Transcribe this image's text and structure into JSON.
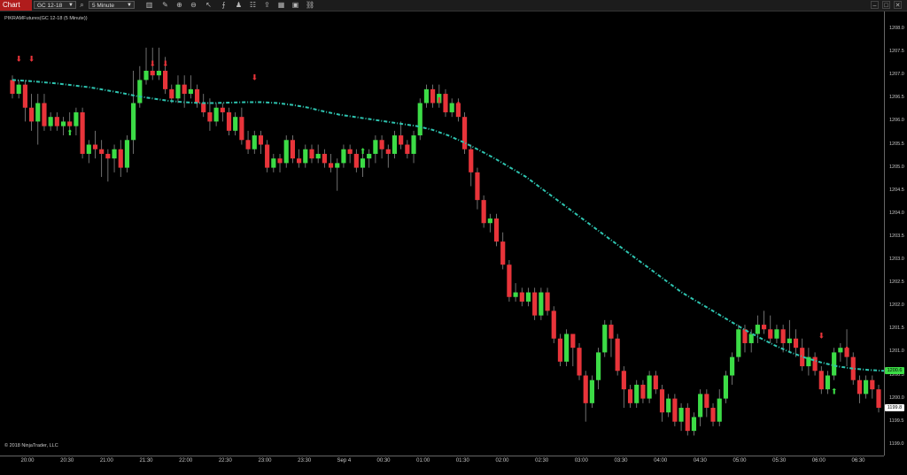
{
  "toolbar": {
    "chart_tab": "Chart",
    "instrument": "GC 12-18",
    "interval": "5 Minute",
    "icons": [
      "search-icon",
      "bar-type-icon",
      "pencil-icon",
      "zoom-in-icon",
      "zoom-out-icon",
      "cursor-icon",
      "indicator-icon",
      "strategy-icon",
      "properties-icon",
      "share-icon",
      "grid-icon",
      "data-box-icon",
      "link-icon"
    ],
    "window_buttons": [
      "minimize-icon",
      "maximize-icon",
      "close-icon"
    ]
  },
  "indicator_label": "PIKRAMFutures(GC 12-18 (5 Minute))",
  "copyright": "© 2018 NinjaTrader, LLC",
  "colors": {
    "up": "#3cdc46",
    "down": "#e8343a",
    "ma": "#2ec4b0",
    "up_arrow": "#3cdc46",
    "down_arrow": "#e8343a"
  },
  "chart_data": {
    "type": "candlestick",
    "instrument": "GC 12-18",
    "interval": "5 Minute",
    "y_tick_labels": [
      "1208.0",
      "1207.5",
      "1207.0",
      "1206.5",
      "1206.0",
      "1205.5",
      "1205.0",
      "1204.5",
      "1204.0",
      "1203.5",
      "1203.0",
      "1202.5",
      "1202.0",
      "1201.5",
      "1201.0",
      "1200.5",
      "1200.0",
      "1199.5",
      "1199.0"
    ],
    "x_tick_labels": [
      "20:00",
      "20:30",
      "21:00",
      "21:30",
      "22:00",
      "22:30",
      "23:00",
      "23:30",
      "Sep 4",
      "00:30",
      "01:00",
      "01:30",
      "02:00",
      "02:30",
      "03:00",
      "03:30",
      "04:00",
      "04:30",
      "05:00",
      "05:30",
      "06:00",
      "06:30"
    ],
    "ylim": [
      1198.5,
      1208.2
    ],
    "last_price_label": "1199.8",
    "ma_price_label": "1200.6",
    "candles": [
      [
        1206.9,
        1206.6,
        1206.5,
        1207.0
      ],
      [
        1206.6,
        1206.8,
        1206.5,
        1206.9
      ],
      [
        1206.8,
        1206.3,
        1206.0,
        1206.9
      ],
      [
        1206.3,
        1206.0,
        1205.8,
        1206.6
      ],
      [
        1206.0,
        1206.4,
        1205.5,
        1206.6
      ],
      [
        1206.4,
        1205.9,
        1205.8,
        1206.6
      ],
      [
        1205.9,
        1206.1,
        1205.8,
        1206.2
      ],
      [
        1206.1,
        1205.9,
        1205.8,
        1206.2
      ],
      [
        1205.9,
        1206.0,
        1205.7,
        1206.1
      ],
      [
        1206.0,
        1205.9,
        1205.8,
        1206.2
      ],
      [
        1205.9,
        1206.2,
        1205.7,
        1206.3
      ],
      [
        1206.2,
        1205.3,
        1205.2,
        1206.3
      ],
      [
        1205.3,
        1205.5,
        1205.1,
        1205.6
      ],
      [
        1205.5,
        1205.4,
        1205.2,
        1205.8
      ],
      [
        1205.4,
        1205.3,
        1204.8,
        1205.6
      ],
      [
        1205.3,
        1205.2,
        1204.7,
        1205.4
      ],
      [
        1205.2,
        1205.4,
        1204.9,
        1205.5
      ],
      [
        1205.4,
        1205.0,
        1204.8,
        1205.6
      ],
      [
        1205.0,
        1205.6,
        1204.9,
        1205.7
      ],
      [
        1205.6,
        1206.4,
        1205.3,
        1207.1
      ],
      [
        1206.4,
        1206.9,
        1206.3,
        1207.2
      ],
      [
        1206.9,
        1207.1,
        1206.8,
        1207.6
      ],
      [
        1207.1,
        1207.0,
        1206.9,
        1207.6
      ],
      [
        1207.0,
        1207.1,
        1206.9,
        1207.6
      ],
      [
        1207.1,
        1206.7,
        1206.6,
        1207.4
      ],
      [
        1206.7,
        1206.5,
        1206.4,
        1206.8
      ],
      [
        1206.5,
        1206.8,
        1206.4,
        1207.0
      ],
      [
        1206.8,
        1206.6,
        1206.3,
        1207.0
      ],
      [
        1206.6,
        1206.7,
        1206.5,
        1207.0
      ],
      [
        1206.7,
        1206.4,
        1206.3,
        1206.8
      ],
      [
        1206.4,
        1206.2,
        1206.1,
        1206.6
      ],
      [
        1206.2,
        1206.0,
        1205.8,
        1206.5
      ],
      [
        1206.0,
        1206.3,
        1205.9,
        1206.4
      ],
      [
        1206.3,
        1206.2,
        1206.0,
        1206.4
      ],
      [
        1206.2,
        1205.8,
        1205.7,
        1206.3
      ],
      [
        1205.8,
        1206.1,
        1205.7,
        1206.2
      ],
      [
        1206.1,
        1205.6,
        1205.5,
        1206.3
      ],
      [
        1205.6,
        1205.4,
        1205.3,
        1205.8
      ],
      [
        1205.4,
        1205.7,
        1205.3,
        1205.8
      ],
      [
        1205.7,
        1205.5,
        1205.3,
        1205.8
      ],
      [
        1205.5,
        1205.0,
        1204.9,
        1205.6
      ],
      [
        1205.0,
        1205.2,
        1204.9,
        1205.3
      ],
      [
        1205.2,
        1205.1,
        1204.9,
        1205.3
      ],
      [
        1205.1,
        1205.6,
        1205.0,
        1205.7
      ],
      [
        1205.6,
        1205.2,
        1205.1,
        1205.7
      ],
      [
        1205.2,
        1205.1,
        1205.0,
        1205.4
      ],
      [
        1205.1,
        1205.4,
        1205.0,
        1205.5
      ],
      [
        1205.4,
        1205.2,
        1205.1,
        1205.5
      ],
      [
        1205.2,
        1205.3,
        1205.1,
        1205.5
      ],
      [
        1205.3,
        1205.1,
        1205.0,
        1205.4
      ],
      [
        1205.1,
        1205.0,
        1204.9,
        1205.3
      ],
      [
        1205.0,
        1205.1,
        1204.5,
        1205.2
      ],
      [
        1205.1,
        1205.4,
        1205.0,
        1205.5
      ],
      [
        1205.4,
        1205.3,
        1205.1,
        1205.5
      ],
      [
        1205.3,
        1205.0,
        1204.9,
        1205.4
      ],
      [
        1205.0,
        1205.2,
        1204.8,
        1205.3
      ],
      [
        1205.2,
        1205.3,
        1205.0,
        1205.4
      ],
      [
        1205.3,
        1205.6,
        1205.1,
        1205.7
      ],
      [
        1205.6,
        1205.4,
        1205.2,
        1205.7
      ],
      [
        1205.4,
        1205.3,
        1205.0,
        1205.5
      ],
      [
        1205.3,
        1205.7,
        1205.2,
        1205.8
      ],
      [
        1205.7,
        1205.5,
        1205.4,
        1206.0
      ],
      [
        1205.5,
        1205.3,
        1205.2,
        1205.6
      ],
      [
        1205.3,
        1205.7,
        1205.1,
        1205.8
      ],
      [
        1205.7,
        1206.4,
        1205.6,
        1206.5
      ],
      [
        1206.4,
        1206.7,
        1206.3,
        1206.8
      ],
      [
        1206.7,
        1206.4,
        1206.3,
        1206.8
      ],
      [
        1206.4,
        1206.6,
        1206.3,
        1206.8
      ],
      [
        1206.6,
        1206.2,
        1206.1,
        1206.7
      ],
      [
        1206.2,
        1206.4,
        1206.1,
        1206.5
      ],
      [
        1206.4,
        1206.1,
        1206.0,
        1206.5
      ],
      [
        1206.1,
        1205.4,
        1205.3,
        1206.2
      ],
      [
        1205.4,
        1204.9,
        1204.6,
        1205.5
      ],
      [
        1204.9,
        1204.3,
        1204.1,
        1205.0
      ],
      [
        1204.3,
        1203.8,
        1203.7,
        1204.4
      ],
      [
        1203.8,
        1203.9,
        1203.6,
        1204.0
      ],
      [
        1203.9,
        1203.4,
        1203.3,
        1204.0
      ],
      [
        1203.4,
        1202.9,
        1202.8,
        1203.6
      ],
      [
        1202.9,
        1202.2,
        1202.1,
        1203.0
      ],
      [
        1202.2,
        1202.3,
        1202.1,
        1202.5
      ],
      [
        1202.3,
        1202.1,
        1202.0,
        1202.4
      ],
      [
        1202.1,
        1202.3,
        1202.0,
        1202.4
      ],
      [
        1202.3,
        1201.8,
        1201.7,
        1202.4
      ],
      [
        1201.8,
        1202.3,
        1201.7,
        1202.4
      ],
      [
        1202.3,
        1201.9,
        1201.8,
        1202.4
      ],
      [
        1201.9,
        1201.3,
        1201.2,
        1202.0
      ],
      [
        1201.3,
        1200.8,
        1200.7,
        1201.4
      ],
      [
        1200.8,
        1201.4,
        1200.7,
        1201.5
      ],
      [
        1201.4,
        1201.1,
        1200.7,
        1201.4
      ],
      [
        1201.1,
        1200.5,
        1200.4,
        1201.2
      ],
      [
        1200.5,
        1199.9,
        1199.5,
        1200.6
      ],
      [
        1199.9,
        1200.4,
        1199.8,
        1200.5
      ],
      [
        1200.4,
        1201.0,
        1200.2,
        1201.1
      ],
      [
        1201.0,
        1201.6,
        1200.9,
        1201.7
      ],
      [
        1201.6,
        1201.3,
        1200.9,
        1201.7
      ],
      [
        1201.3,
        1200.6,
        1200.5,
        1201.4
      ],
      [
        1200.6,
        1200.2,
        1199.8,
        1200.7
      ],
      [
        1200.2,
        1199.9,
        1199.8,
        1200.3
      ],
      [
        1199.9,
        1200.3,
        1199.8,
        1200.4
      ],
      [
        1200.3,
        1200.0,
        1199.9,
        1200.4
      ],
      [
        1200.0,
        1200.5,
        1199.9,
        1200.6
      ],
      [
        1200.5,
        1200.2,
        1200.1,
        1200.6
      ],
      [
        1200.2,
        1199.7,
        1199.5,
        1200.3
      ],
      [
        1199.7,
        1200.0,
        1199.6,
        1200.1
      ],
      [
        1200.0,
        1199.5,
        1199.4,
        1200.1
      ],
      [
        1199.5,
        1199.8,
        1199.3,
        1199.9
      ],
      [
        1199.8,
        1199.3,
        1199.2,
        1199.9
      ],
      [
        1199.3,
        1199.6,
        1199.2,
        1199.7
      ],
      [
        1199.6,
        1200.1,
        1199.4,
        1200.2
      ],
      [
        1200.1,
        1199.8,
        1199.6,
        1200.2
      ],
      [
        1199.8,
        1199.5,
        1199.4,
        1199.9
      ],
      [
        1199.5,
        1200.0,
        1199.4,
        1200.2
      ],
      [
        1200.0,
        1200.5,
        1199.9,
        1200.6
      ],
      [
        1200.5,
        1200.9,
        1200.3,
        1201.0
      ],
      [
        1200.9,
        1201.5,
        1200.8,
        1201.6
      ],
      [
        1201.5,
        1201.2,
        1201.0,
        1201.6
      ],
      [
        1201.2,
        1201.4,
        1201.0,
        1201.5
      ],
      [
        1201.4,
        1201.6,
        1201.2,
        1201.8
      ],
      [
        1201.6,
        1201.5,
        1201.4,
        1201.9
      ],
      [
        1201.5,
        1201.3,
        1201.2,
        1201.8
      ],
      [
        1201.3,
        1201.5,
        1201.2,
        1201.6
      ],
      [
        1201.5,
        1201.2,
        1201.0,
        1201.6
      ],
      [
        1201.2,
        1201.3,
        1201.0,
        1201.7
      ],
      [
        1201.3,
        1201.1,
        1200.9,
        1201.5
      ],
      [
        1201.1,
        1200.7,
        1200.6,
        1201.3
      ],
      [
        1200.7,
        1200.9,
        1200.5,
        1201.1
      ],
      [
        1200.9,
        1200.6,
        1200.5,
        1201.0
      ],
      [
        1200.6,
        1200.2,
        1200.1,
        1200.7
      ],
      [
        1200.2,
        1200.5,
        1200.1,
        1200.6
      ],
      [
        1200.5,
        1201.0,
        1200.4,
        1201.1
      ],
      [
        1201.0,
        1201.1,
        1200.8,
        1201.2
      ],
      [
        1201.1,
        1200.9,
        1200.7,
        1201.5
      ],
      [
        1200.9,
        1200.4,
        1200.3,
        1201.0
      ],
      [
        1200.4,
        1200.1,
        1199.9,
        1200.5
      ],
      [
        1200.1,
        1200.4,
        1200.0,
        1200.5
      ],
      [
        1200.4,
        1200.2,
        1200.0,
        1200.5
      ],
      [
        1200.2,
        1199.8,
        1199.7,
        1200.3
      ]
    ],
    "ma": [
      1206.9,
      1206.88,
      1206.85,
      1206.82,
      1206.78,
      1206.74,
      1206.68,
      1206.62,
      1206.55,
      1206.5,
      1206.45,
      1206.42,
      1206.4,
      1206.4,
      1206.41,
      1206.42,
      1206.42,
      1206.4,
      1206.36,
      1206.3,
      1206.22,
      1206.15,
      1206.1,
      1206.05,
      1206.0,
      1205.95,
      1205.9,
      1205.82,
      1205.7,
      1205.55,
      1205.38,
      1205.2,
      1205.0,
      1204.8,
      1204.55,
      1204.3,
      1204.05,
      1203.8,
      1203.55,
      1203.3,
      1203.05,
      1202.8,
      1202.55,
      1202.3,
      1202.1,
      1201.9,
      1201.7,
      1201.5,
      1201.32,
      1201.15,
      1201.0,
      1200.88,
      1200.78,
      1200.7,
      1200.65,
      1200.62,
      1200.6
    ],
    "down_arrows": [
      [
        1,
        1207.3
      ],
      [
        3,
        1207.3
      ],
      [
        22,
        1207.2
      ],
      [
        24,
        1207.2
      ],
      [
        38,
        1206.9
      ],
      [
        67,
        1206.4
      ],
      [
        70,
        1206.3
      ],
      [
        127,
        1201.3
      ],
      [
        131,
        1201.0
      ]
    ],
    "up_arrows": [
      [
        9,
        1205.7
      ],
      [
        55,
        1205.3
      ],
      [
        129,
        1200.1
      ],
      [
        139,
        1200.2
      ]
    ]
  }
}
